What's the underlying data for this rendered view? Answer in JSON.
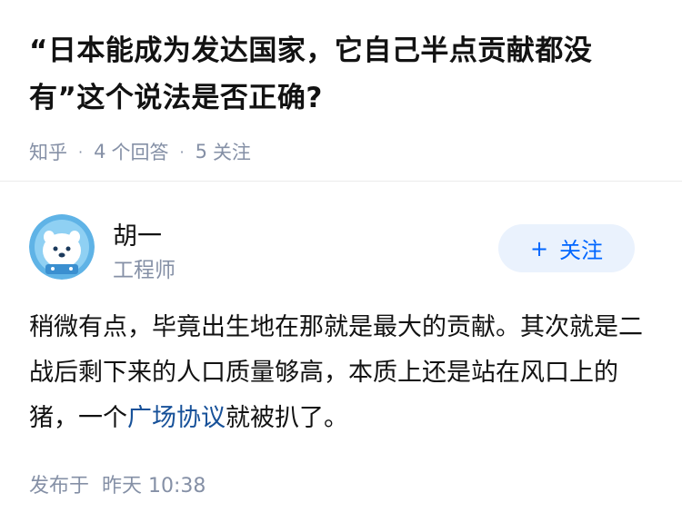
{
  "question": {
    "title": "“日本能成为发达国家，它自己半点贡献都没有”这个说法是否正确?",
    "source": "知乎",
    "answer_count": "4",
    "answer_label": "个回答",
    "follower_count": "5",
    "follower_label": "关注"
  },
  "author": {
    "name": "胡一",
    "title": "工程师",
    "follow_label": "关注",
    "follow_icon": "plus-icon"
  },
  "answer": {
    "text_before_link": "稍微有点，毕竟出生地在那就是最大的贡献。其次就是二战后剩下来的人口质量够高，本质上还是站在风口上的猪，一个",
    "link_text": "广场协议",
    "text_after_link": "就被扒了。"
  },
  "footer": {
    "published_label": "发布于",
    "published_time": "昨天 10:38"
  },
  "colors": {
    "accent": "#0066ff",
    "follow_bg": "#eaf2fd",
    "meta_gray": "#8590a6",
    "link": "#175199",
    "avatar_bg": "#5fb3e6"
  }
}
